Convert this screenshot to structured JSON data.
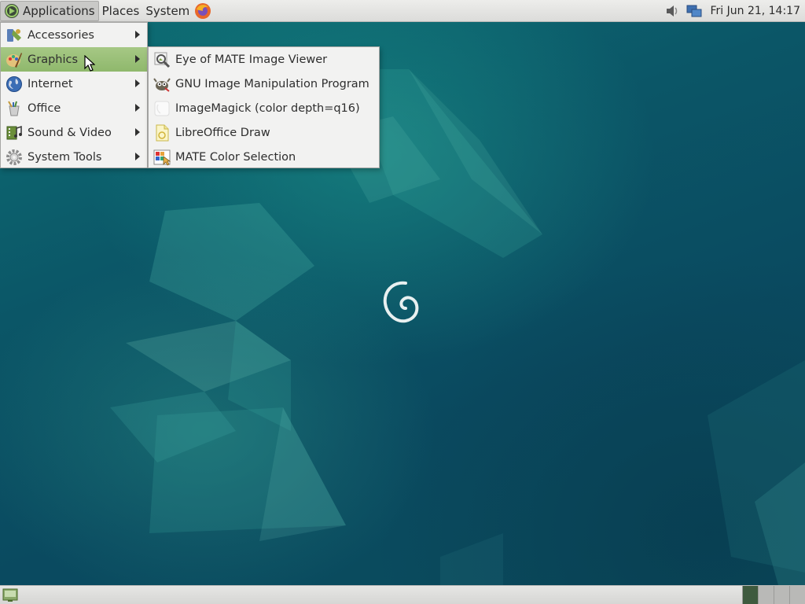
{
  "top_panel": {
    "menus": [
      {
        "label": "Applications"
      },
      {
        "label": "Places"
      },
      {
        "label": "System"
      }
    ],
    "launcher_icon": "firefox-icon",
    "tray_icons": [
      "volume-icon",
      "network-icon"
    ],
    "clock": "Fri Jun 21, 14:17"
  },
  "applications_menu": {
    "items": [
      {
        "label": "Accessories",
        "icon": "accessories-icon",
        "has_submenu": true
      },
      {
        "label": "Graphics",
        "icon": "graphics-icon",
        "has_submenu": true,
        "highlighted": true
      },
      {
        "label": "Internet",
        "icon": "internet-globe-icon",
        "has_submenu": true
      },
      {
        "label": "Office",
        "icon": "office-icon",
        "has_submenu": true
      },
      {
        "label": "Sound & Video",
        "icon": "sound-video-icon",
        "has_submenu": true
      },
      {
        "label": "System Tools",
        "icon": "system-tools-gear-icon",
        "has_submenu": true
      }
    ]
  },
  "graphics_submenu": {
    "items": [
      {
        "label": "Eye of MATE Image Viewer",
        "icon": "image-viewer-icon"
      },
      {
        "label": "GNU Image Manipulation Program",
        "icon": "gimp-icon"
      },
      {
        "label": "ImageMagick (color depth=q16)",
        "icon": "imagemagick-icon"
      },
      {
        "label": "LibreOffice Draw",
        "icon": "libreoffice-draw-icon"
      },
      {
        "label": "MATE Color Selection",
        "icon": "color-selection-icon"
      }
    ]
  },
  "bottom_panel": {
    "show_desktop_icon": "show-desktop-icon",
    "workspace_count": 4,
    "current_workspace": 1
  },
  "colors": {
    "menu_highlight": "#9cc07a",
    "panel_bg": "#e4e4e2",
    "desktop_bg": "#0b4a5e"
  }
}
